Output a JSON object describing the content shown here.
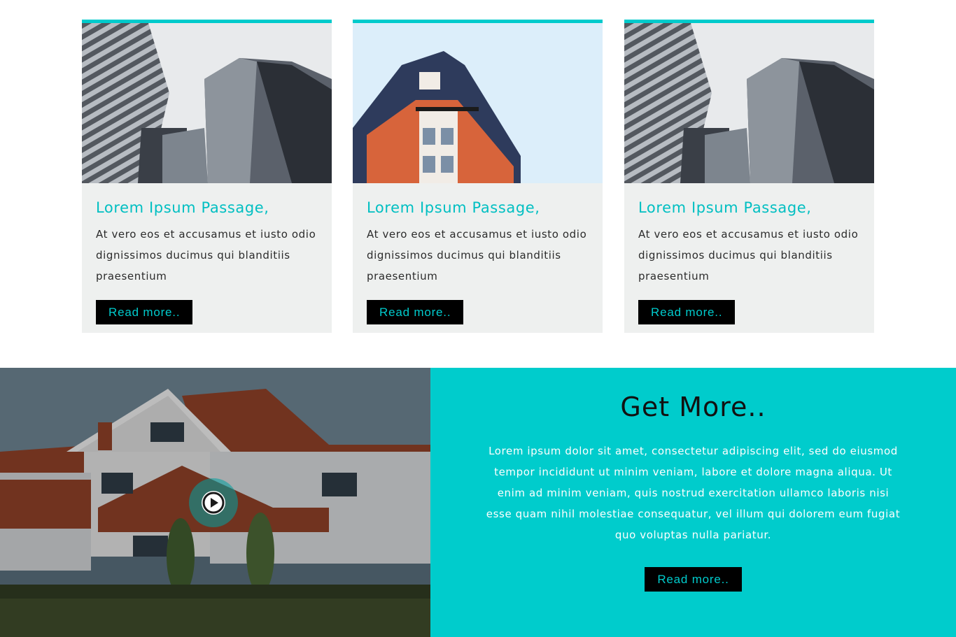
{
  "cards": [
    {
      "title": "Lorem Ipsum Passage,",
      "text": "At vero eos et accusamus et iusto odio dignissimos ducimus qui blanditiis praesentium",
      "button": "Read more..",
      "image": "skyscrapers-photo"
    },
    {
      "title": "Lorem Ipsum Passage,",
      "text": "At vero eos et accusamus et iusto odio dignissimos ducimus qui blanditiis praesentium",
      "button": "Read more..",
      "image": "corner-building-photo"
    },
    {
      "title": "Lorem Ipsum Passage,",
      "text": "At vero eos et accusamus et iusto odio dignissimos ducimus qui blanditiis praesentium",
      "button": "Read more..",
      "image": "skyscrapers-photo"
    }
  ],
  "promo": {
    "title": "Get More..",
    "text": "Lorem ipsum dolor sit amet, consectetur adipiscing elit, sed do eiusmod tempor incididunt ut minim veniam, labore et dolore magna aliqua. Ut enim ad minim veniam, quis nostrud exercitation ullamco laboris nisi esse quam nihil molestiae consequatur, vel illum qui dolorem eum fugiat quo voluptas nulla pariatur.",
    "button": "Read more.."
  },
  "video": {
    "icon": "play-icon",
    "image": "house-photo"
  },
  "colors": {
    "accent": "#00cccc",
    "button_bg": "#000000",
    "card_bg": "#eef0ef"
  }
}
